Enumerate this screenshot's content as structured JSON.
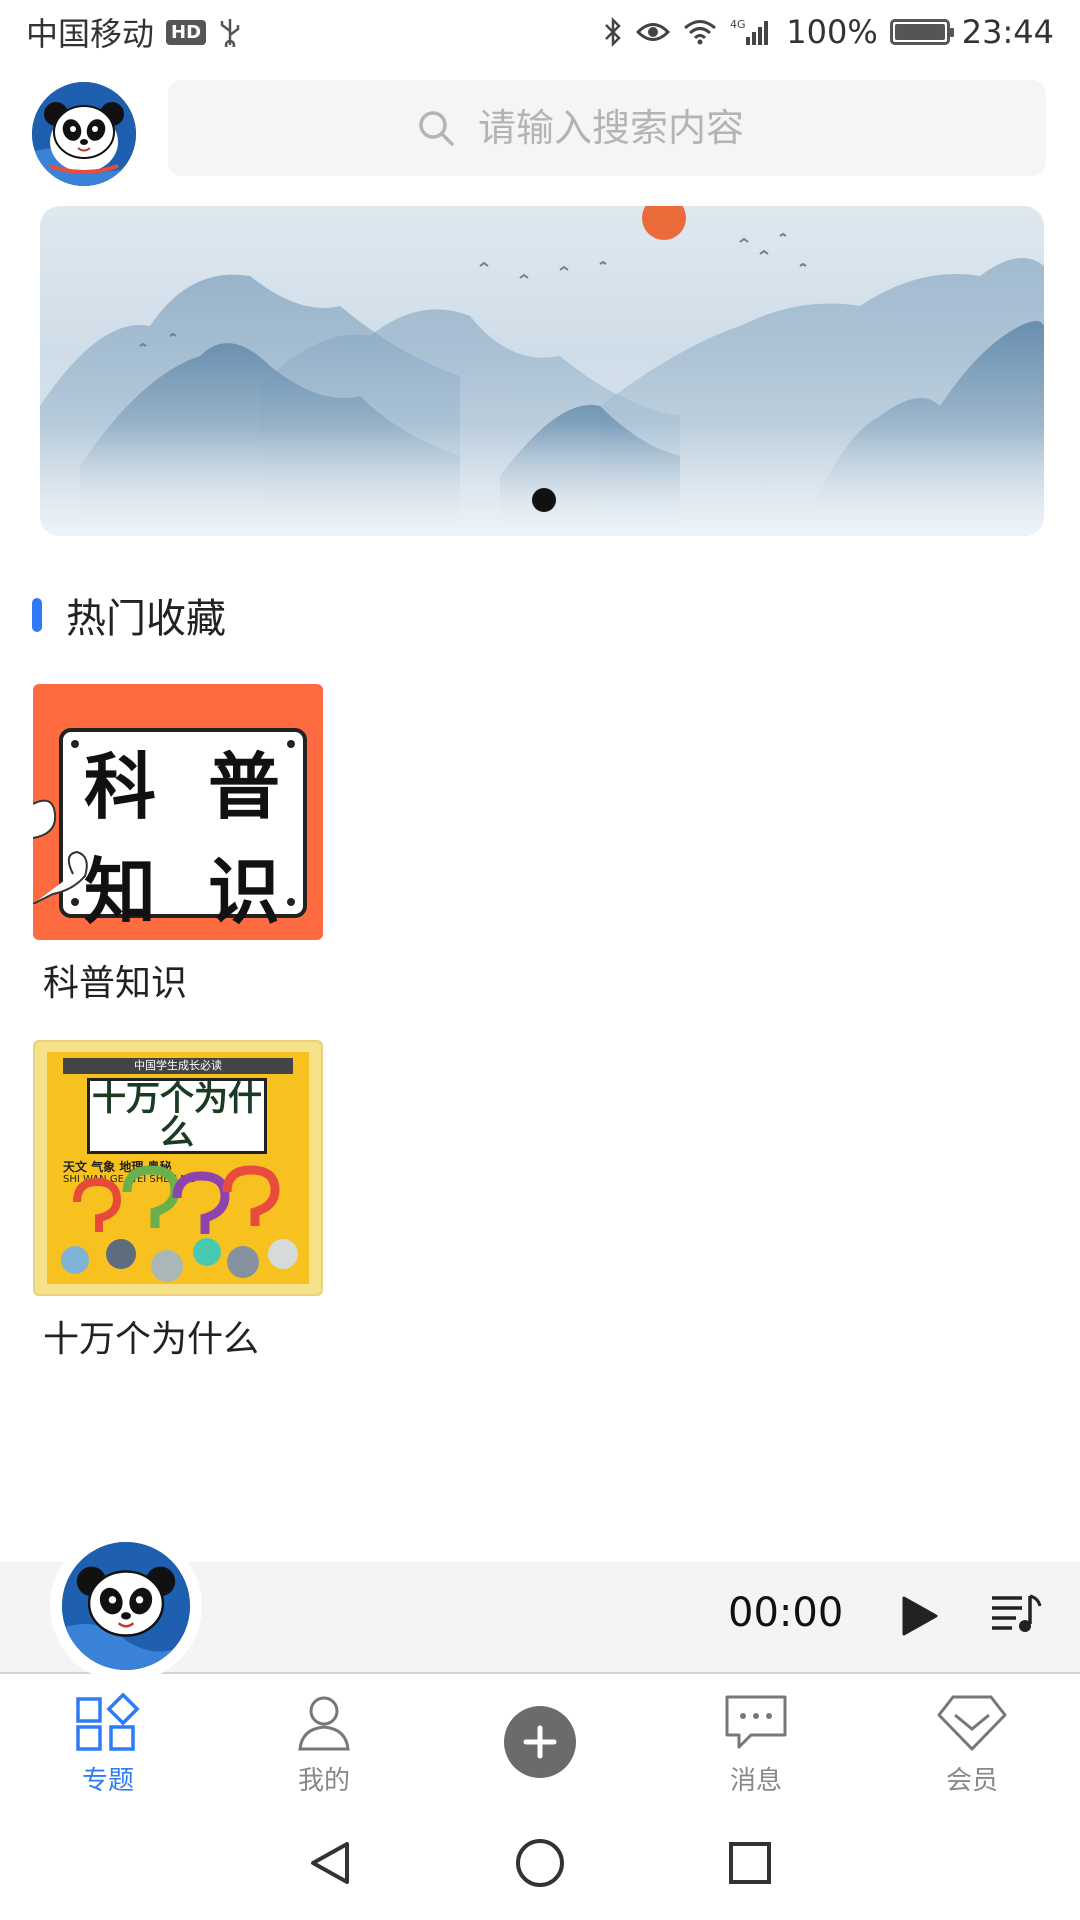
{
  "status_bar": {
    "carrier": "中国移动",
    "hd_badge": "HD",
    "network": "4G",
    "battery_percent": "100%",
    "battery_level": 1.0,
    "time": "23:44",
    "icons": [
      "usb-icon",
      "bluetooth-icon",
      "eye-icon",
      "wifi-icon",
      "signal-icon",
      "battery-icon"
    ]
  },
  "header": {
    "avatar_icon": "panda-avatar",
    "search": {
      "placeholder": "请输入搜索内容",
      "value": "",
      "icon": "search-icon"
    }
  },
  "banner": {
    "image": "ink-landscape",
    "page_count": 1,
    "active_index": 0
  },
  "section": {
    "title": "热门收藏",
    "accent_color": "#2f7bf5"
  },
  "favorites": [
    {
      "title": "科普知识",
      "cover_text": [
        "科",
        "普",
        "知",
        "识"
      ],
      "cover_color": "#fe6b41"
    },
    {
      "title": "十万个为什么",
      "cover_strip": "中国学生成长必读",
      "cover_title": "十万个为什么",
      "cover_sub": "天文 气象 地理 奥秘",
      "cover_pinyin": "SHI WAN GE WEI SHEN ME",
      "cover_color": "#f7c21f"
    }
  ],
  "player": {
    "time": "00:00",
    "play_icon": "play-icon",
    "playlist_icon": "playlist-icon",
    "artwork_icon": "panda-avatar"
  },
  "bottom_nav": [
    {
      "label": "专题",
      "icon": "grid-icon",
      "active": true
    },
    {
      "label": "我的",
      "icon": "user-icon",
      "active": false
    },
    {
      "label": "",
      "icon": "add-icon",
      "active": false
    },
    {
      "label": "消息",
      "icon": "message-icon",
      "active": false
    },
    {
      "label": "会员",
      "icon": "diamond-icon",
      "active": false
    }
  ],
  "system_nav": [
    "back-icon",
    "home-icon",
    "recents-icon"
  ],
  "colors": {
    "accent": "#2f7bf5",
    "nav_inactive": "#888888",
    "player_bg": "#f4f4f4"
  }
}
